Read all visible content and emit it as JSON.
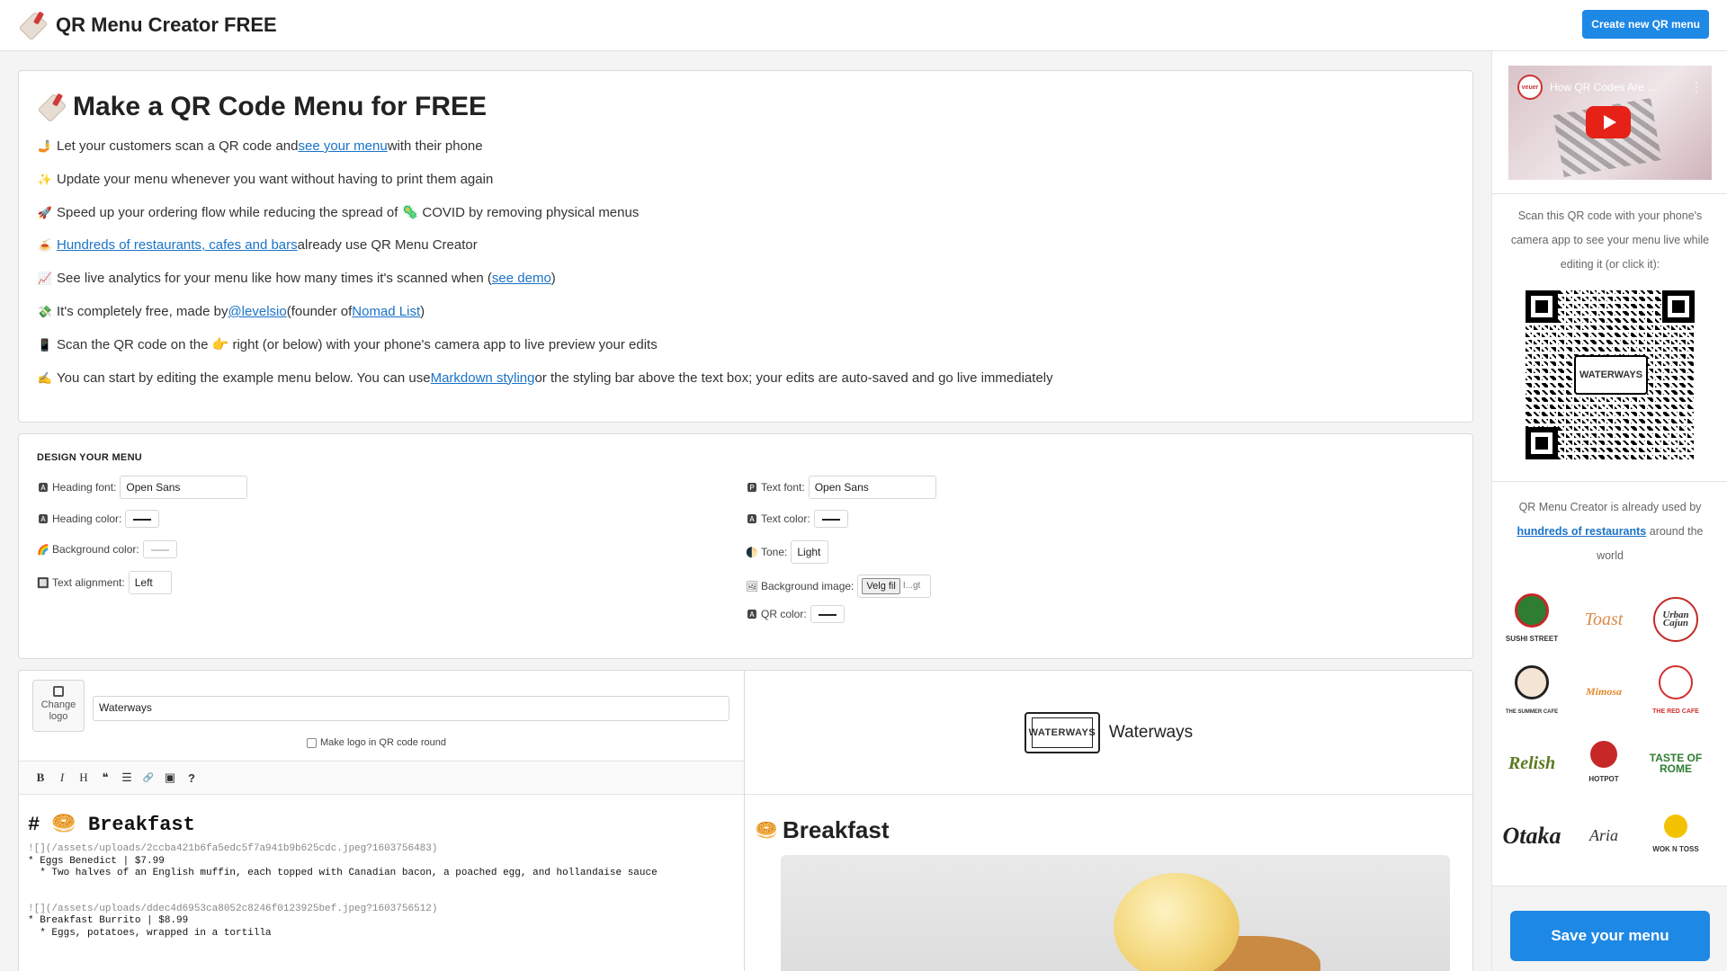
{
  "header": {
    "title": "QR Menu Creator FREE",
    "create_button": "Create new QR menu"
  },
  "intro": {
    "title": "Make a QR Code Menu for FREE",
    "items": [
      {
        "emoji": "🤳",
        "before": "Let your customers scan a QR code and ",
        "link": "see your menu",
        "after": " with their phone"
      },
      {
        "emoji": "✨",
        "before": "Update your menu whenever you want without having to print them again",
        "link": "",
        "after": ""
      },
      {
        "emoji": "🚀",
        "before": "Speed up your ordering flow while reducing the spread of 🦠 COVID by removing physical menus",
        "link": "",
        "after": ""
      },
      {
        "emoji": "🍝",
        "before": "",
        "link": "Hundreds of restaurants, cafes and bars",
        "after": " already use QR Menu Creator"
      },
      {
        "emoji": "📈",
        "before": "See live analytics for your menu like how many times it's scanned when (",
        "link": "see demo",
        "after": ")"
      },
      {
        "emoji": "💸",
        "before": "It's completely free, made by ",
        "link": "@levelsio",
        "after": " (founder of ",
        "link2": "Nomad List",
        "after2": ")"
      },
      {
        "emoji": "📱",
        "before": "Scan the QR code on the 👉 right (or below) with your phone's camera app to live preview your edits",
        "link": "",
        "after": ""
      },
      {
        "emoji": "✍️",
        "before": "You can start by editing the example menu below. You can use ",
        "link": "Markdown styling",
        "after": " or the styling bar above the text box; your edits are auto-saved and go live immediately"
      }
    ]
  },
  "design": {
    "title": "DESIGN YOUR MENU",
    "heading_font_label": "Heading font:",
    "heading_font_value": "Open Sans",
    "heading_color_label": "Heading color:",
    "background_color_label": "Background color:",
    "text_alignment_label": "Text alignment:",
    "text_alignment_value": "Left",
    "text_font_label": "Text font:",
    "text_font_value": "Open Sans",
    "text_color_label": "Text color:",
    "tone_label": "Tone:",
    "tone_value": "Light",
    "background_image_label": "Background image:",
    "file_button": "Velg fil",
    "file_name": "I...gt",
    "qr_color_label": "QR color:",
    "icons": {
      "heading_font": "🅰",
      "heading_color": "🅰",
      "background_color": "🌈",
      "text_alignment": "🔲",
      "text_font": "🅿",
      "text_color": "🅰",
      "tone": "🌓",
      "background_image": "🖼",
      "qr_color": "🅰"
    }
  },
  "editor": {
    "change_logo": "Change logo",
    "restaurant_name": "Waterways",
    "round_logo_label": "Make logo in QR code round",
    "toolbar": [
      "B",
      "I",
      "H",
      "❝",
      "☰",
      "🔗",
      "▣",
      "?"
    ],
    "heading": "# 🥯 Breakfast",
    "blocks": [
      {
        "link": "![](/assets/uploads/2ccba421b6fa5edc5f7a941b9b625cdc.jpeg?1603756483)",
        "item": "* Eggs Benedict | $7.99",
        "desc": "  * Two halves of an English muffin, each topped with Canadian bacon, a poached egg, and hollandaise sauce"
      },
      {
        "link": "![](/assets/uploads/ddec4d6953ca8052c8246f0123925bef.jpeg?1603756512)",
        "item": "* Breakfast Burrito | $8.99",
        "desc": "  * Eggs, potatoes, wrapped in a tortilla"
      }
    ]
  },
  "preview": {
    "logo_text": "WATERWAYS",
    "name": "Waterways",
    "section_emoji": "🥯",
    "section_title": "Breakfast"
  },
  "sidebar": {
    "video_channel": "veuer",
    "video_title": "How QR Codes Are ...",
    "video_menu": "⋮",
    "scan_text": "Scan this QR code with your phone's camera app to see your menu live while editing it (or click it):",
    "qr_logo_text": "WATERWAYS",
    "used_before": "QR Menu Creator is already used by ",
    "used_link": "hundreds of restaurants",
    "used_after": " around the world",
    "logos": [
      "SUSHI STREET",
      "Toast",
      "Urban Cajun",
      "THE SUMMER CAFE",
      "Mimosa",
      "THE RED CAFE",
      "Relish",
      "HOTPOT",
      "TASTE OF ROME",
      "Otaka",
      "Aria",
      "WOK N TOSS"
    ],
    "save_button": "Save your menu"
  }
}
